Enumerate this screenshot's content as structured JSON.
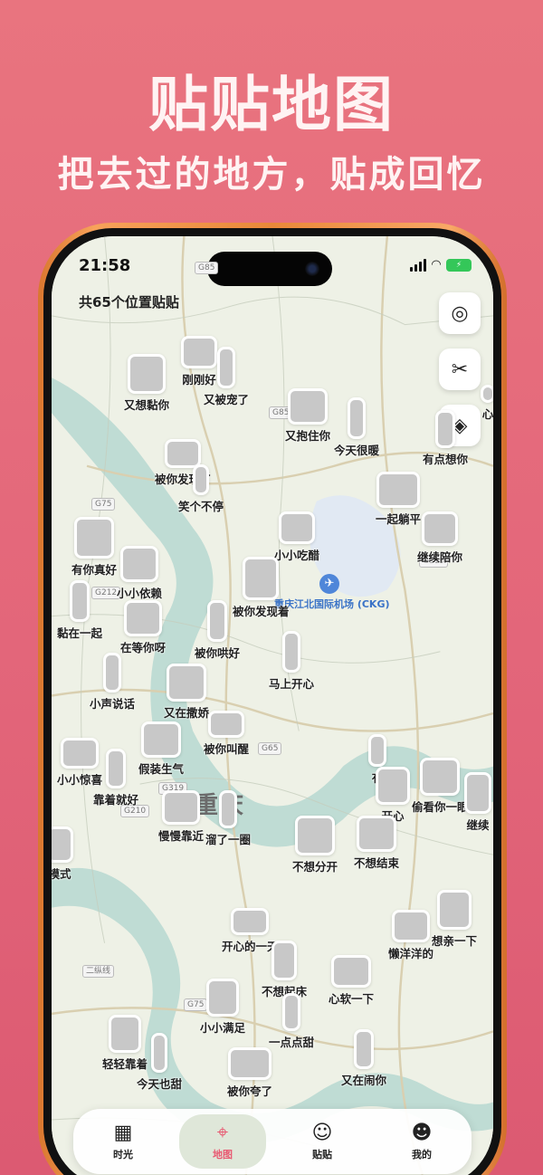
{
  "hero": {
    "title": "贴贴地图",
    "subtitle": "把去过的地方，贴成回忆"
  },
  "status": {
    "time": "21:58",
    "battery": "⚡"
  },
  "map": {
    "location_count": "共65个位置贴贴",
    "airport": "重庆江北国际机场 (CKG)",
    "city": "重庆",
    "roads": [
      "G85",
      "G85",
      "G75",
      "G212",
      "G319",
      "G65",
      "G319",
      "G210",
      "二纵线",
      "G75"
    ]
  },
  "stickers": [
    "刚刚好",
    "又被宠了",
    "又想黏你",
    "又抱住你",
    "今天很暖",
    "有点想你",
    "被你发现了",
    "笑个不停",
    "一起躺平",
    "继续陪你",
    "有你真好",
    "小小依赖",
    "小小吃醋",
    "被你发现着",
    "黏在一起",
    "在等你呀",
    "被你哄好",
    "马上开心",
    "小声说话",
    "又在撒娇",
    "被你叫醒",
    "小小惊喜",
    "假装生气",
    "靠着就好",
    "慢慢靠近",
    "溜了一圈",
    "偷看你一眼",
    "继续",
    "有",
    "开心",
    "不想分开",
    "不想结束",
    "模式",
    "开心的一天",
    "想亲一下",
    "懒洋洋的",
    "不想起床",
    "心软一下",
    "小小满足",
    "一点点甜",
    "轻轻靠着",
    "今天也甜",
    "被你夸了",
    "又在闹你",
    "心"
  ],
  "side_buttons": {
    "locate": "◎",
    "cut": "✂",
    "layers": "◈"
  },
  "tabs": [
    {
      "label": "时光",
      "icon": "calendar-icon",
      "glyph": "▦"
    },
    {
      "label": "地图",
      "icon": "map-pin-icon",
      "glyph": "⌖"
    },
    {
      "label": "贴贴",
      "icon": "sticker-icon",
      "glyph": "☺"
    },
    {
      "label": "我的",
      "icon": "profile-icon",
      "glyph": "☻"
    }
  ],
  "colors": {
    "accent": "#e85a72",
    "background": "#e9747f",
    "frame": "#f39a52",
    "map": "#eef1e6"
  }
}
